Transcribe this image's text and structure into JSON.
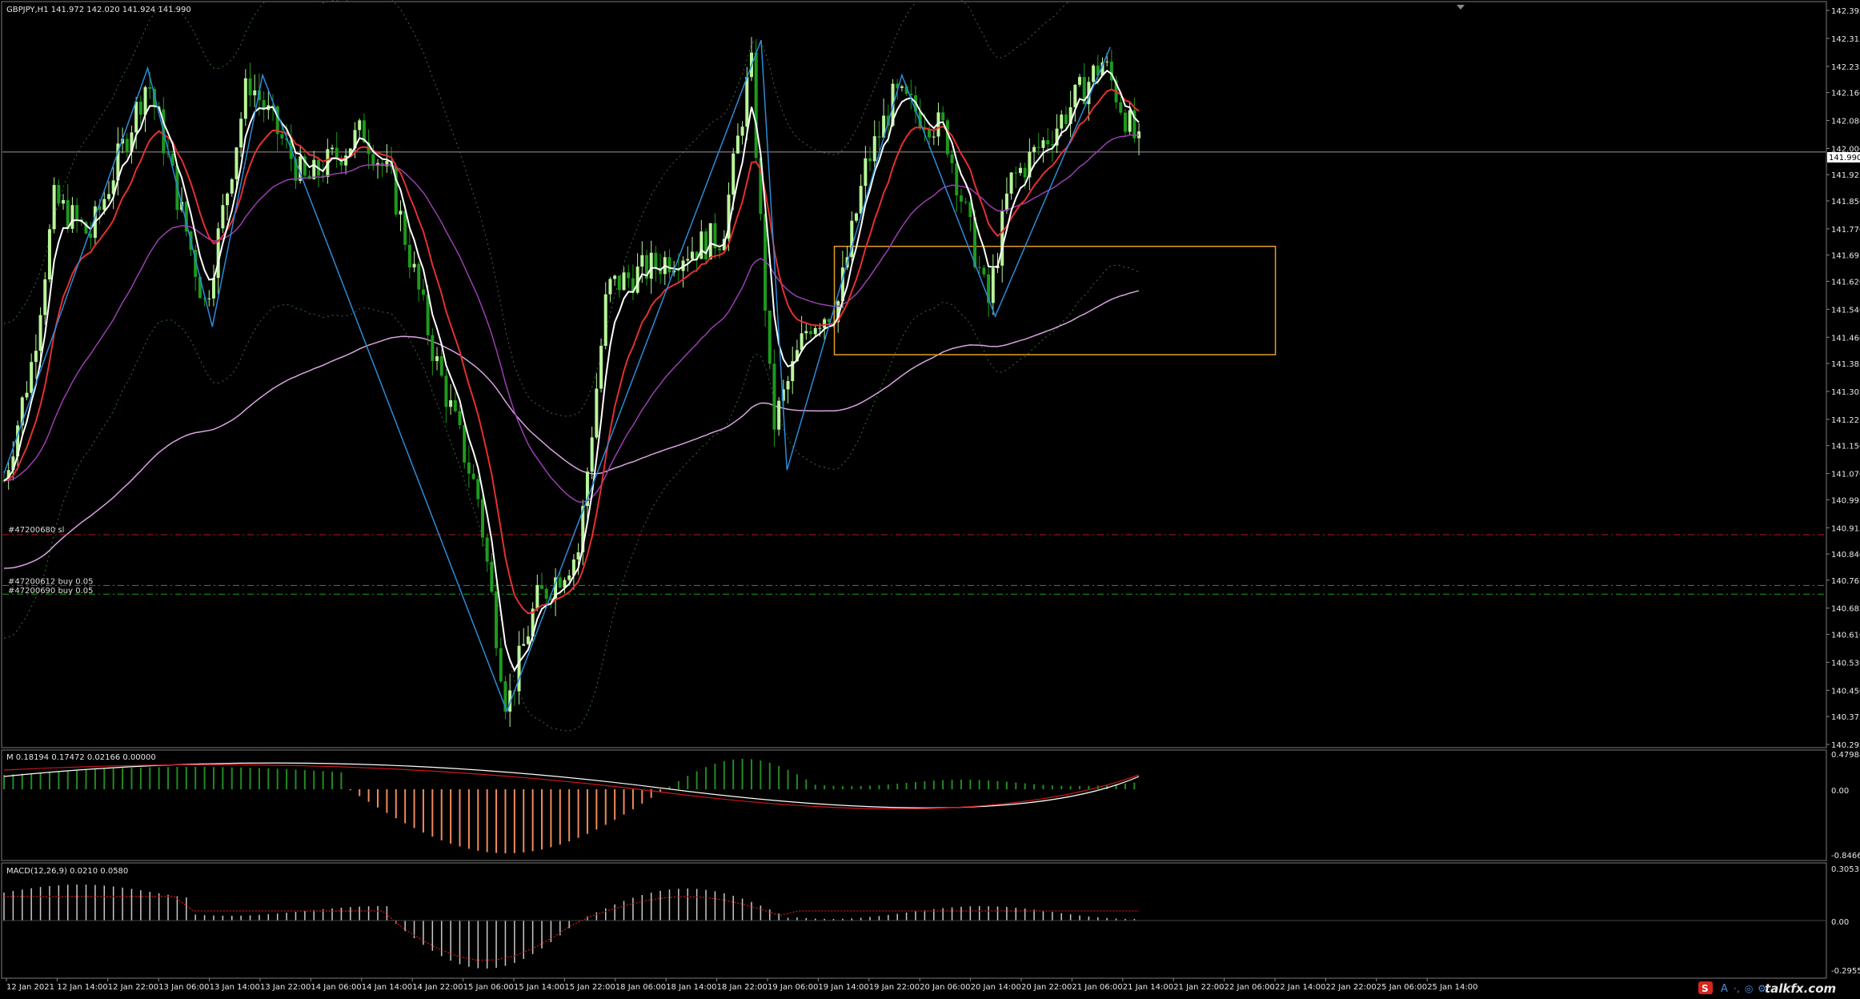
{
  "header": {
    "symbol_info": "GBPJPY,H1  141.972 142.020 141.924 141.990"
  },
  "price_axis": {
    "ticks": [
      "142.395",
      "142.315",
      "142.235",
      "142.160",
      "142.080",
      "142.000",
      "141.925",
      "141.850",
      "141.770",
      "141.695",
      "141.620",
      "141.540",
      "141.460",
      "141.385",
      "141.305",
      "141.225",
      "141.150",
      "141.070",
      "140.995",
      "140.915",
      "140.840",
      "140.765",
      "140.685",
      "140.610",
      "140.530",
      "140.450",
      "140.375",
      "140.295"
    ],
    "current_price": "141.990"
  },
  "time_axis": {
    "labels": [
      "12 Jan 2021",
      "12 Jan 14:00",
      "12 Jan 22:00",
      "13 Jan 06:00",
      "13 Jan 14:00",
      "13 Jan 22:00",
      "14 Jan 06:00",
      "14 Jan 14:00",
      "14 Jan 22:00",
      "15 Jan 06:00",
      "15 Jan 14:00",
      "15 Jan 22:00",
      "18 Jan 06:00",
      "18 Jan 14:00",
      "18 Jan 22:00",
      "19 Jan 06:00",
      "19 Jan 14:00",
      "19 Jan 22:00",
      "20 Jan 06:00",
      "20 Jan 14:00",
      "20 Jan 22:00",
      "21 Jan 06:00",
      "21 Jan 14:00",
      "21 Jan 22:00",
      "22 Jan 06:00",
      "22 Jan 14:00",
      "22 Jan 22:00",
      "25 Jan 06:00",
      "25 Jan 14:00"
    ]
  },
  "orders": {
    "sl_label": "#47200680 sl",
    "buy1_label": "#47200612 buy 0.05",
    "buy2_label": "#47200690 buy 0.05"
  },
  "momentum": {
    "label": "M 0.18194 0.17472 0.02166 0.00000",
    "ticks": [
      "0.47988",
      "0.00",
      "-0.84669"
    ]
  },
  "macd": {
    "label": "MACD(12,26,9) 0.0210 0.0580",
    "ticks": [
      "0.3053",
      "0.00",
      "-0.2955"
    ]
  },
  "watermark": "talkfx.com",
  "colors": {
    "background": "#000000",
    "bull_candle": "#b8f59a",
    "bear_candle": "#1e9a1e",
    "ma_fast": "#ffffff",
    "ma_mid": "#e53030",
    "ma_slow": "#9a3fb0",
    "ma_long": "#d8a4e0",
    "zigzag": "#2a8cd8",
    "bands": "#3c6a3c",
    "box": "#e0a020",
    "sl_line": "#c01818",
    "buy_line": "#1ea01e",
    "mom_pos": "#228b22",
    "mom_neg": "#f08a5a",
    "macd_hist": "#c8c8c8",
    "macd_signal": "#d01818"
  },
  "chart_data": {
    "type": "candlestick",
    "symbol": "GBPJPY",
    "timeframe": "H1",
    "ylim": [
      140.295,
      142.395
    ],
    "price_path": [
      {
        "x": 0,
        "p": 141.05
      },
      {
        "x": 0.02,
        "p": 141.4
      },
      {
        "x": 0.035,
        "p": 141.85
      },
      {
        "x": 0.06,
        "p": 141.75
      },
      {
        "x": 0.1,
        "p": 142.2
      },
      {
        "x": 0.14,
        "p": 141.55
      },
      {
        "x": 0.17,
        "p": 142.2
      },
      {
        "x": 0.21,
        "p": 141.9
      },
      {
        "x": 0.25,
        "p": 142.05
      },
      {
        "x": 0.27,
        "p": 141.9
      },
      {
        "x": 0.3,
        "p": 141.4
      },
      {
        "x": 0.33,
        "p": 141.0
      },
      {
        "x": 0.35,
        "p": 140.4
      },
      {
        "x": 0.37,
        "p": 140.7
      },
      {
        "x": 0.4,
        "p": 140.85
      },
      {
        "x": 0.42,
        "p": 141.6
      },
      {
        "x": 0.47,
        "p": 141.7
      },
      {
        "x": 0.5,
        "p": 141.75
      },
      {
        "x": 0.52,
        "p": 142.25
      },
      {
        "x": 0.535,
        "p": 141.2
      },
      {
        "x": 0.56,
        "p": 141.5
      },
      {
        "x": 0.58,
        "p": 141.55
      },
      {
        "x": 0.6,
        "p": 141.95
      },
      {
        "x": 0.62,
        "p": 142.15
      },
      {
        "x": 0.655,
        "p": 142.05
      },
      {
        "x": 0.685,
        "p": 141.55
      },
      {
        "x": 0.7,
        "p": 141.9
      },
      {
        "x": 0.73,
        "p": 142.05
      },
      {
        "x": 0.765,
        "p": 142.25
      },
      {
        "x": 0.79,
        "p": 142.0
      }
    ],
    "zigzag": [
      {
        "x": 0,
        "p": 141.07
      },
      {
        "x": 0.1,
        "p": 142.23
      },
      {
        "x": 0.145,
        "p": 141.49
      },
      {
        "x": 0.18,
        "p": 142.21
      },
      {
        "x": 0.35,
        "p": 140.39
      },
      {
        "x": 0.527,
        "p": 142.31
      },
      {
        "x": 0.545,
        "p": 141.08
      },
      {
        "x": 0.625,
        "p": 142.21
      },
      {
        "x": 0.69,
        "p": 141.52
      },
      {
        "x": 0.77,
        "p": 142.29
      }
    ],
    "box": {
      "x0": 0.578,
      "x1": 0.885,
      "p_top": 141.72,
      "p_bottom": 141.41
    },
    "sl_level": 140.895,
    "buy_levels": [
      140.75,
      140.725
    ],
    "current_price": 141.99
  }
}
